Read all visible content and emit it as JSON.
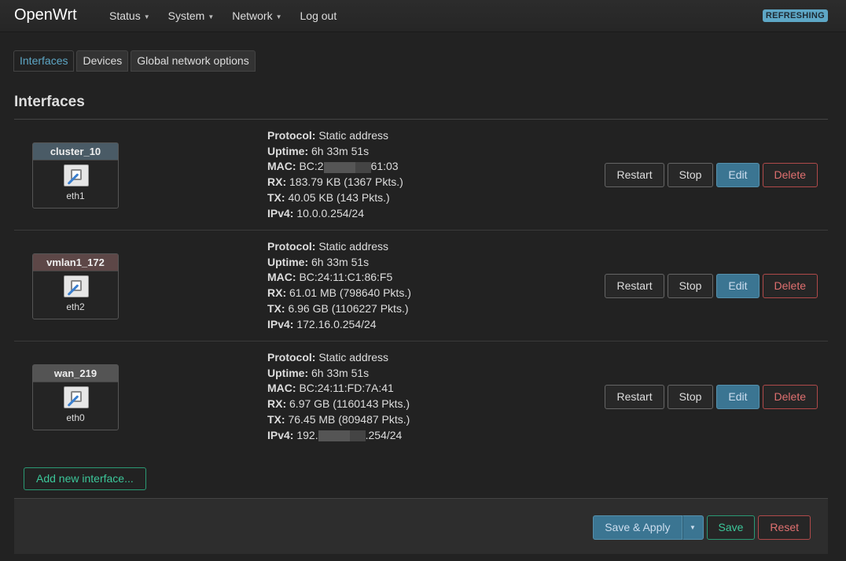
{
  "app": {
    "brand": "OpenWrt",
    "refresh_badge": "REFRESHING"
  },
  "menu": [
    {
      "label": "Status",
      "has_dropdown": true
    },
    {
      "label": "System",
      "has_dropdown": true
    },
    {
      "label": "Network",
      "has_dropdown": true
    },
    {
      "label": "Log out",
      "has_dropdown": false
    }
  ],
  "tabs": [
    {
      "label": "Interfaces",
      "active": true
    },
    {
      "label": "Devices",
      "active": false
    },
    {
      "label": "Global network options",
      "active": false
    }
  ],
  "page_title": "Interfaces",
  "field_labels": {
    "protocol": "Protocol:",
    "uptime": "Uptime:",
    "mac": "MAC:",
    "rx": "RX:",
    "tx": "TX:",
    "ipv4": "IPv4:"
  },
  "row_actions": {
    "restart": "Restart",
    "stop": "Stop",
    "edit": "Edit",
    "delete": "Delete"
  },
  "interfaces": [
    {
      "name": "cluster_10",
      "device": "eth1",
      "protocol": "Static address",
      "uptime": "6h 33m 51s",
      "mac_prefix": "BC:2",
      "mac_suffix": "61:03",
      "rx": "183.79 KB (1367 Pkts.)",
      "tx": "40.05 KB (143 Pkts.)",
      "ipv4": "10.0.0.254/24"
    },
    {
      "name": "vmlan1_172",
      "device": "eth2",
      "protocol": "Static address",
      "uptime": "6h 33m 51s",
      "mac": "BC:24:11:C1:86:F5",
      "rx": "61.01 MB (798640 Pkts.)",
      "tx": "6.96 GB (1106227 Pkts.)",
      "ipv4": "172.16.0.254/24"
    },
    {
      "name": "wan_219",
      "device": "eth0",
      "protocol": "Static address",
      "uptime": "6h 33m 51s",
      "mac": "BC:24:11:FD:7A:41",
      "rx": "6.97 GB (1160143 Pkts.)",
      "tx": "76.45 MB (809487 Pkts.)",
      "ipv4_prefix": "192.",
      "ipv4_suffix": ".254/24"
    }
  ],
  "add_interface_label": "Add new interface...",
  "footer": {
    "save_apply": "Save & Apply",
    "save": "Save",
    "reset": "Reset"
  },
  "colors": {
    "accent": "#5ea7c6",
    "primary_button": "#3b7592",
    "danger": "#e07070",
    "positive": "#3cc79a"
  }
}
